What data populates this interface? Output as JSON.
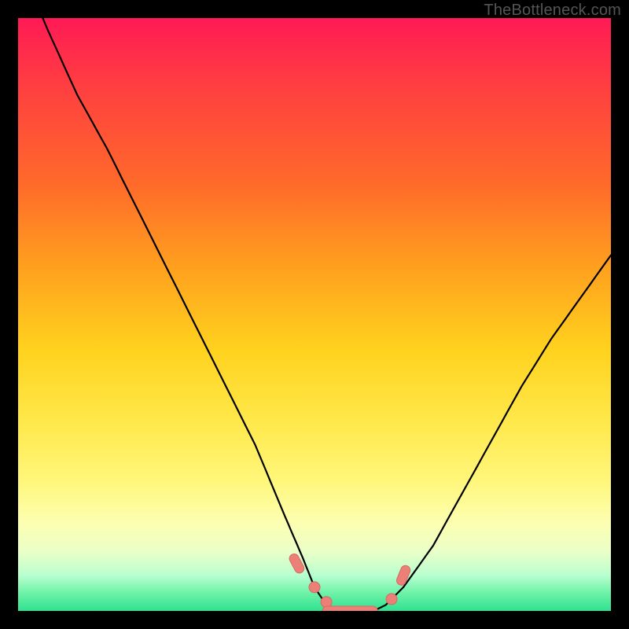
{
  "watermark": {
    "text": "TheBottleneck.com"
  },
  "colors": {
    "background": "#000000",
    "curve_stroke": "#000000",
    "marker_fill": "#ec7f78",
    "marker_stroke": "#d46b63",
    "gradient_top": "#ff1a55",
    "gradient_bottom": "#2fe28f"
  },
  "chart_data": {
    "type": "line",
    "title": "",
    "xlabel": "",
    "ylabel": "",
    "xlim": [
      0,
      100
    ],
    "ylim": [
      0,
      100
    ],
    "grid": false,
    "legend": false,
    "series": [
      {
        "name": "bottleneck-curve",
        "x": [
          0,
          5,
          10,
          15,
          20,
          25,
          30,
          35,
          40,
          45,
          48,
          50,
          52,
          55,
          58,
          60,
          62,
          65,
          70,
          75,
          80,
          85,
          90,
          95,
          100
        ],
        "values": [
          110,
          98,
          87,
          78,
          68,
          58,
          48,
          38,
          28,
          16,
          9,
          4,
          1,
          0,
          0,
          0,
          1,
          4,
          11,
          20,
          29,
          38,
          46,
          53,
          60
        ]
      }
    ],
    "markers": [
      {
        "x": 47,
        "y": 8,
        "shape": "pill"
      },
      {
        "x": 50,
        "y": 4,
        "shape": "round"
      },
      {
        "x": 52,
        "y": 1.5,
        "shape": "round"
      },
      {
        "x": 56,
        "y": 0,
        "shape": "bar"
      },
      {
        "x": 63,
        "y": 2,
        "shape": "round"
      },
      {
        "x": 65,
        "y": 6,
        "shape": "pill"
      }
    ]
  }
}
